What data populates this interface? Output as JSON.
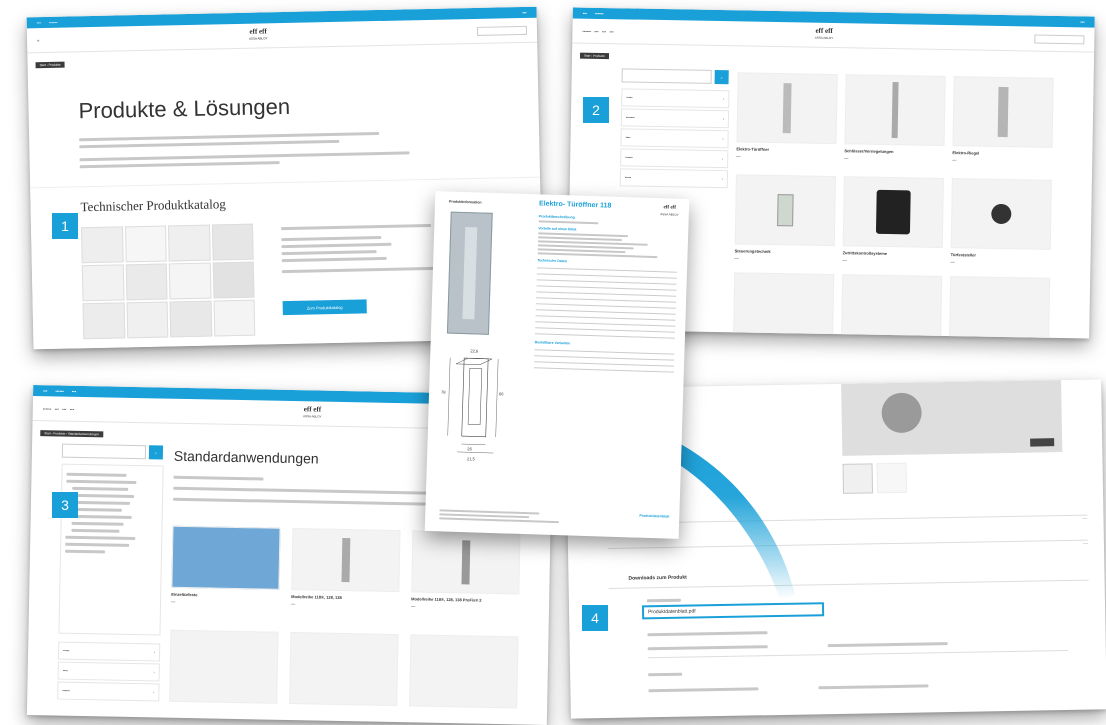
{
  "panel1": {
    "title": "Produkte & Lösungen",
    "catalog_title": "Technischer Produktkatalog",
    "catalog_button": "Zum Produktkatalog",
    "badge": "1"
  },
  "panel2": {
    "badge": "2",
    "tiles": [
      "Elektro-Türöffner",
      "Schlösser/Verriegelungen",
      "Elektro-Riegel",
      "Steuerungstechnik",
      "Zutrittskontrollsysteme",
      "Türfeststeller"
    ]
  },
  "panel3": {
    "badge": "3",
    "title": "Standardanwendungen",
    "tiles": [
      "Einzeltürfeste",
      "Modellreihe 118®, 128, 138",
      "Modellreihe 118®, 128, 138 ProFix® 2"
    ]
  },
  "panel4": {
    "badge": "4",
    "section": "Downloads zum Produkt",
    "file": "Produktdatenblatt.pdf"
  },
  "document": {
    "title": "Elektro- Türöffner 118",
    "side_label": "Produktinformation",
    "h_desc": "Produktbeschreibung",
    "h_features": "Vorteile auf einen Blick",
    "h_tech": "Technische Daten",
    "h_variants": "Bestellbare Varianten",
    "dims": [
      "22,6",
      "26",
      "21,5",
      "82",
      "78",
      "66",
      "1",
      "10",
      "9,3",
      "0,75"
    ],
    "footer": "Produktdatenblatt"
  }
}
